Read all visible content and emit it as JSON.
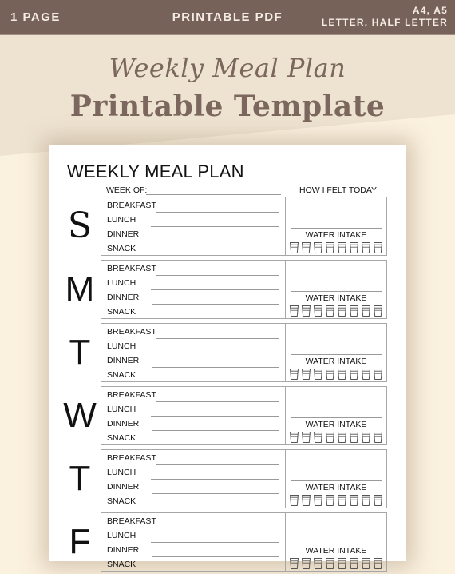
{
  "banner": {
    "left": "1 PAGE",
    "center": "PRINTABLE PDF",
    "right_line1": "A4, A5",
    "right_line2": "LETTER, HALF LETTER"
  },
  "hero": {
    "script_title": "Weekly Meal Plan",
    "title": "Printable Template"
  },
  "colors": {
    "banner": "#766259",
    "hero_text": "#7b675d",
    "bg_upper": "#eee3d1",
    "bg_lower": "#fbf1df"
  },
  "planner": {
    "title": "WEEKLY MEAL PLAN",
    "week_of_label": "WEEK OF:",
    "felt_label": "HOW I FELT TODAY",
    "water_label": "WATER INTAKE",
    "glasses_per_day": 8,
    "meals": [
      "BREAKFAST",
      "LUNCH",
      "DINNER",
      "SNACK"
    ],
    "days": [
      "S",
      "M",
      "T",
      "W",
      "T",
      "F"
    ]
  }
}
